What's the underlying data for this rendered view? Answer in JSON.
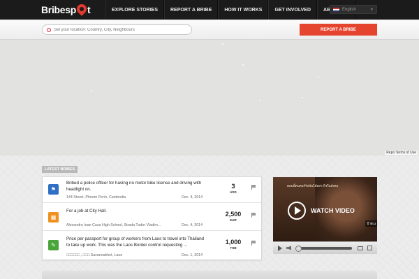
{
  "brand": {
    "logo_left": "Bribesp",
    "logo_right": "t"
  },
  "nav": {
    "items": [
      {
        "label": "Explore Stories"
      },
      {
        "label": "Report a Bribe"
      },
      {
        "label": "How it works"
      },
      {
        "label": "Get Involved"
      },
      {
        "label": "About Us"
      }
    ]
  },
  "language": {
    "selected": "English"
  },
  "search": {
    "placeholder": "Set your location: Country, City, Neighbours",
    "value": ""
  },
  "report_button": {
    "label": "Report a Bribe"
  },
  "map": {
    "attribution": "Repo Terms of Use"
  },
  "latest": {
    "tag": "Latest bribes",
    "items": [
      {
        "title": "Bribed a police officer for having no motor bike license and driving with headlight on.",
        "location": "144 Street, Phnom Penh, Cambodia",
        "date": "Dec. 4, 2014",
        "amount": "3",
        "currency": "USD",
        "category_color": "#2f6fc4",
        "category_icon": "police-icon"
      },
      {
        "title": "For a job at City Hall.",
        "location": "Alexandru Ioan Cuza High School, Strada Tudor Vladim...",
        "date": "Dec. 4, 2014",
        "amount": "2,500",
        "currency": "EUR",
        "category_color": "#f0911f",
        "category_icon": "building-icon"
      },
      {
        "title": "Price per passport for group of workers from Laos to travel into Thailand to take up work. This was the Laos Border control requesting ...",
        "location": "□□□□□□ , □□□ Savannakhet, Laos",
        "date": "Dec. 1, 2014",
        "amount": "1,000",
        "currency": "THB",
        "category_color": "#4aa53a",
        "category_icon": "document-icon"
      }
    ]
  },
  "video": {
    "cta": "WATCH VIDEO",
    "caption_top": "ตอนนี้คนคอร์รัปชันได้อย่างไรในสังคม",
    "caption_right": "ป้ายเน"
  }
}
